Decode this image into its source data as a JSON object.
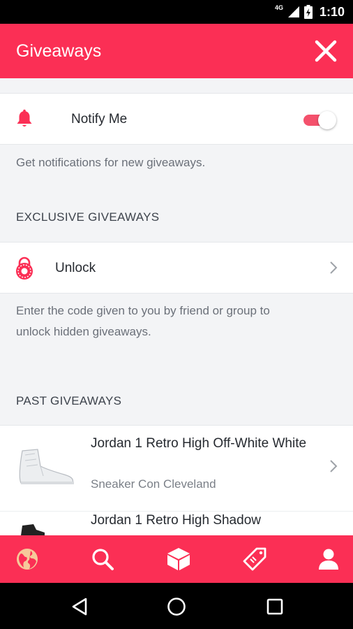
{
  "status_bar": {
    "network": "4G",
    "time": "1:10"
  },
  "app_bar": {
    "title": "Giveaways"
  },
  "notify": {
    "label": "Notify Me",
    "enabled": true,
    "help": "Get notifications for new giveaways."
  },
  "exclusive": {
    "heading": "EXCLUSIVE GIVEAWAYS",
    "unlock_label": "Unlock",
    "help_line1": "Enter the code given to you by friend or group to",
    "help_line2": "unlock hidden giveaways."
  },
  "past": {
    "heading": "PAST GIVEAWAYS",
    "items": [
      {
        "name": "Jordan 1 Retro High Off-White White",
        "event": "Sneaker Con Cleveland"
      },
      {
        "name": "Jordan 1 Retro High Shadow",
        "event": ""
      }
    ]
  },
  "bottom_nav": [
    "globe-icon",
    "search-icon",
    "box-icon",
    "tag-icon",
    "profile-icon"
  ],
  "colors": {
    "brand": "#fb2f55",
    "accent_active": "#f6c99a"
  }
}
